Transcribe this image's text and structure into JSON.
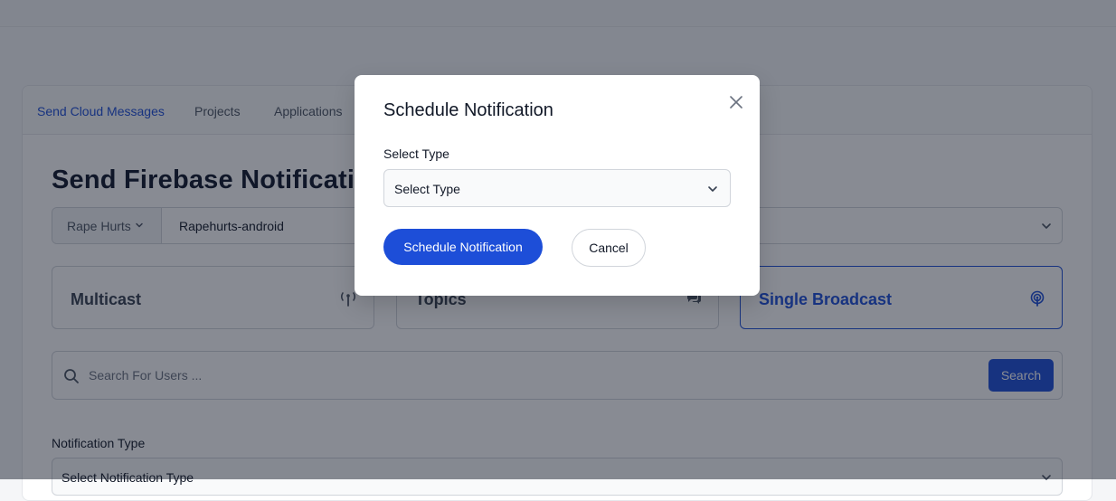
{
  "tabs": [
    {
      "label": "Send Cloud Messages",
      "active": true
    },
    {
      "label": "Projects",
      "active": false
    },
    {
      "label": "Applications",
      "active": false
    }
  ],
  "page": {
    "title": "Send Firebase Notifications",
    "project_prefix": "Rape Hurts",
    "project_value": "Rapehurts-android"
  },
  "message_types": [
    {
      "label": "Multicast",
      "icon": "antenna-icon",
      "active": false
    },
    {
      "label": "Topics",
      "icon": "chat-bubbles-icon",
      "active": false
    },
    {
      "label": "Single Broadcast",
      "icon": "broadcast-icon",
      "active": true
    }
  ],
  "search": {
    "placeholder": "Search For Users ...",
    "button_label": "Search"
  },
  "notification": {
    "label": "Notification Type",
    "select_value": "Select Notification Type"
  },
  "modal": {
    "title": "Schedule Notification",
    "field_label": "Select Type",
    "select_value": "Select Type",
    "primary_button": "Schedule Notification",
    "cancel_button": "Cancel"
  },
  "colors": {
    "accent": "#1d4ed8",
    "overlay": "rgba(17,24,39,0.5)"
  }
}
